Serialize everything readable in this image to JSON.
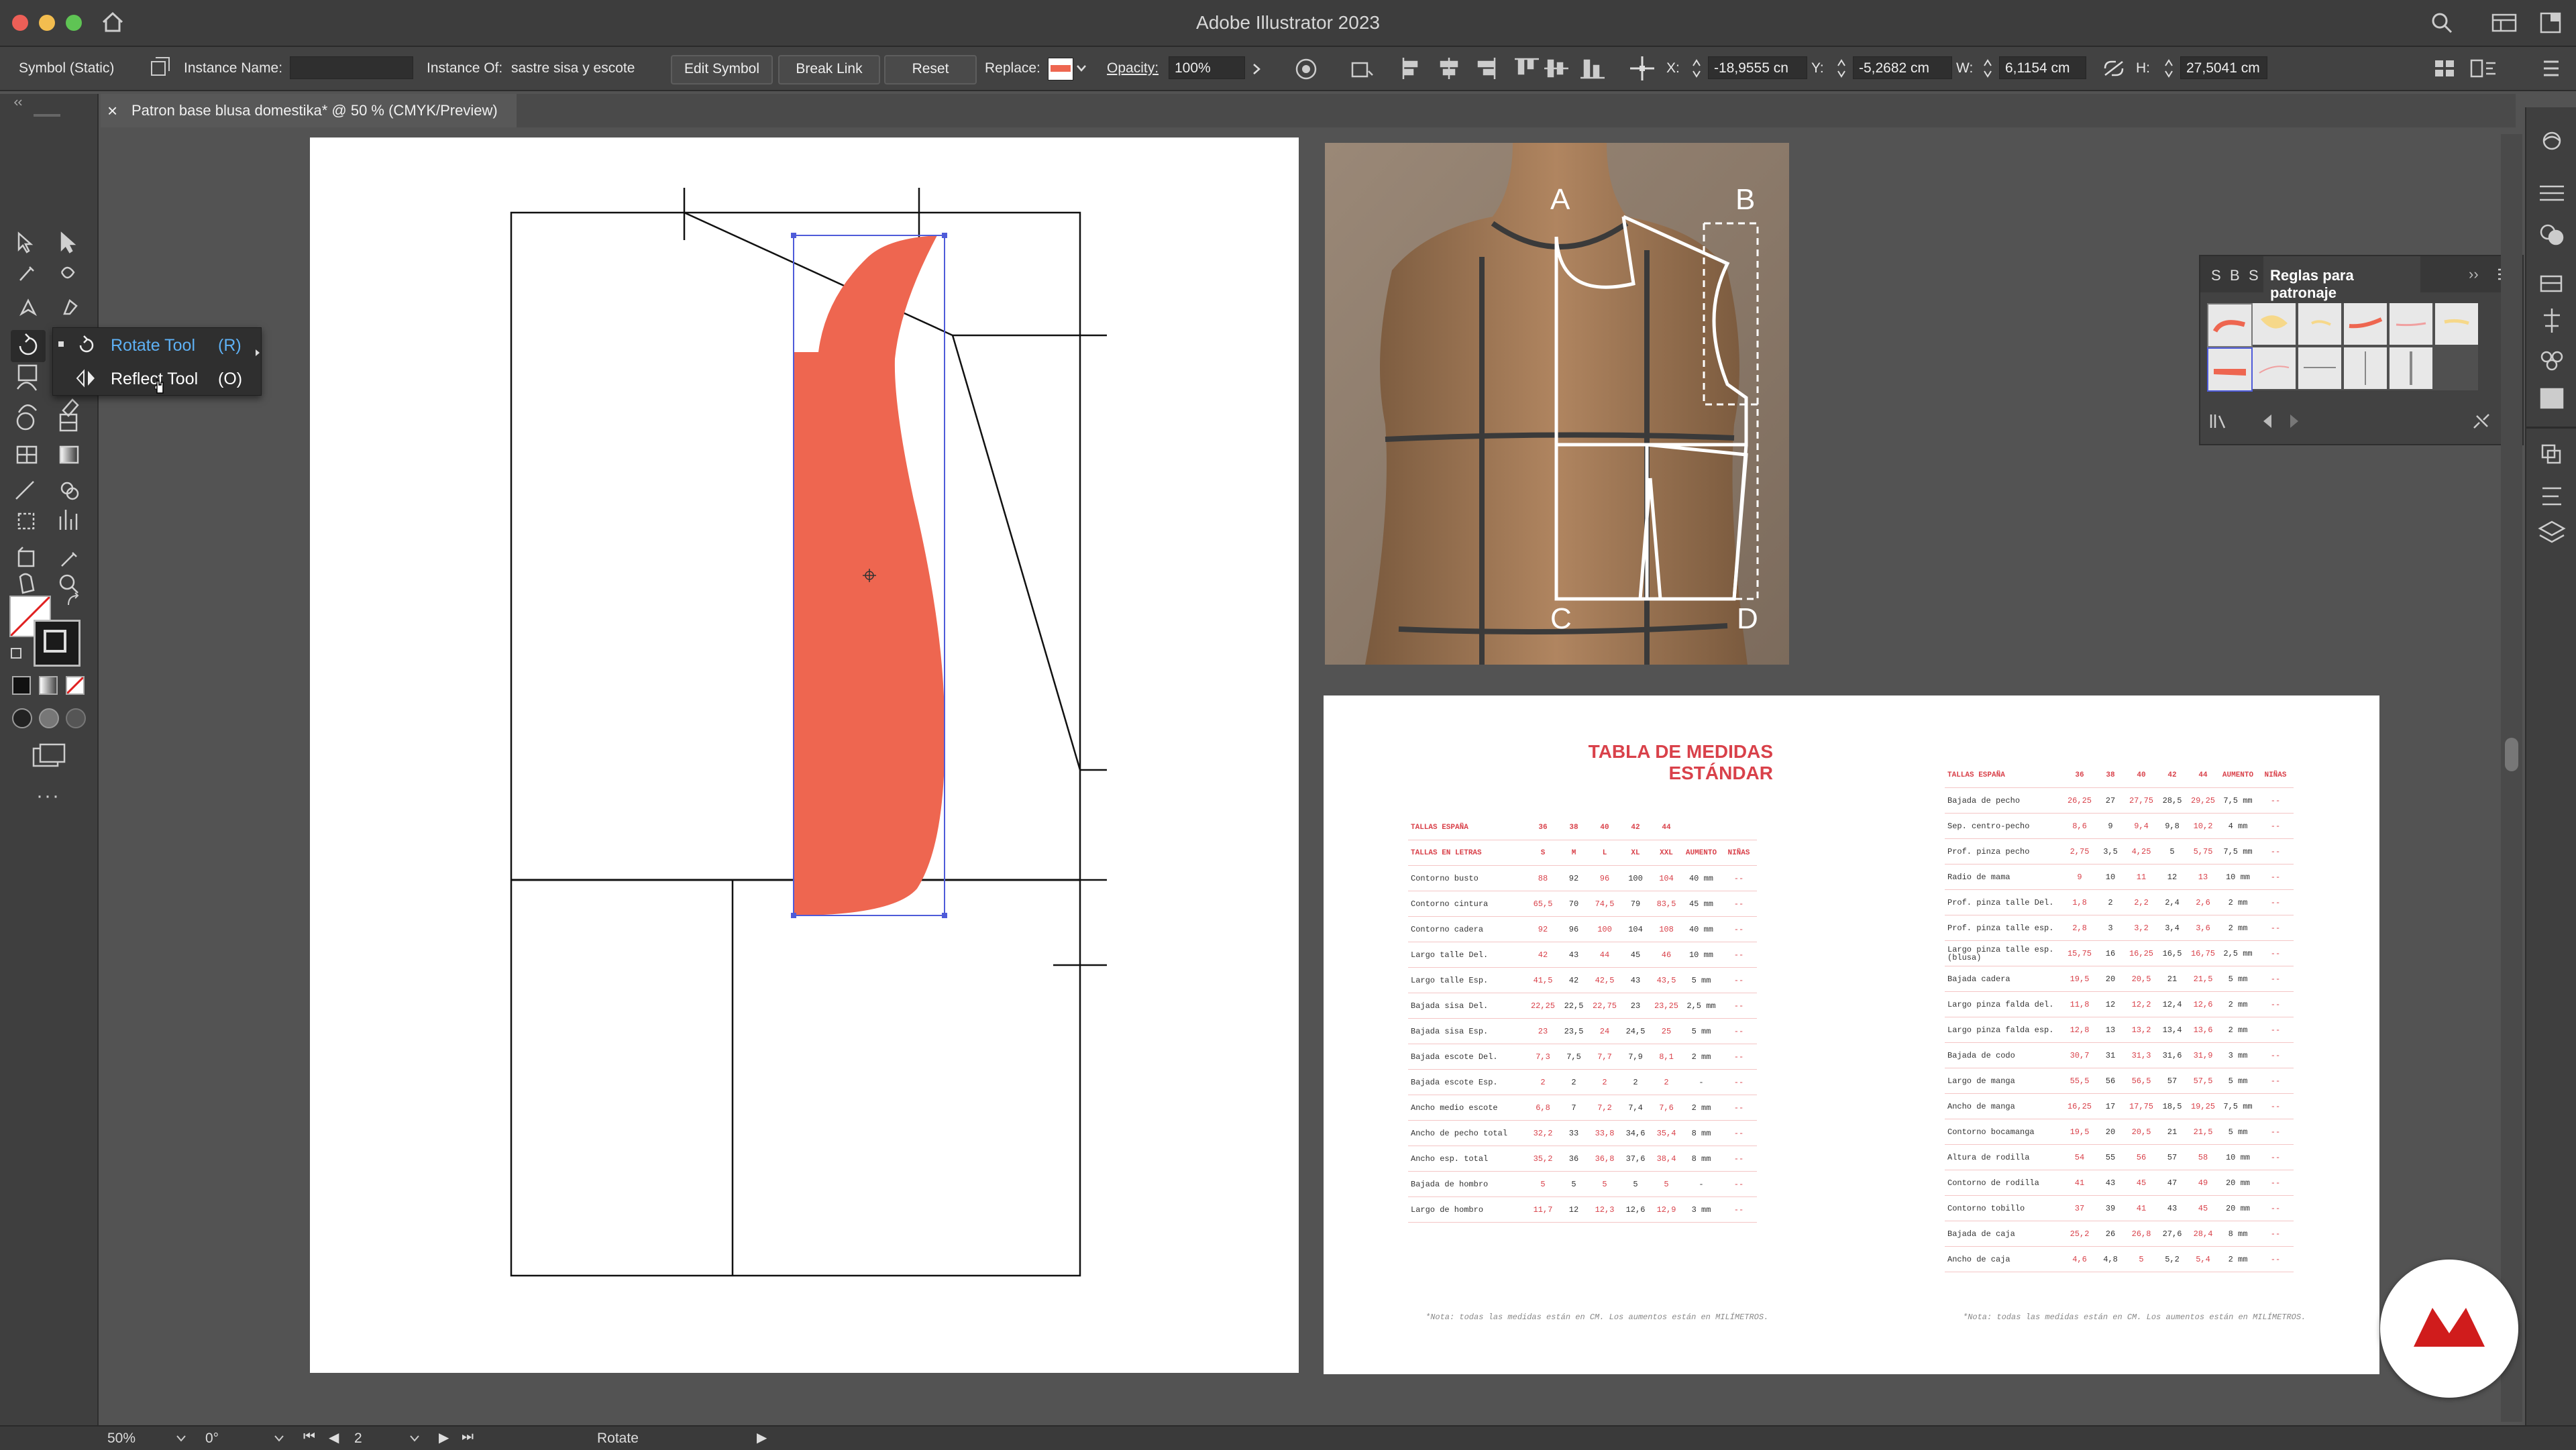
{
  "window": {
    "title": "Adobe Illustrator 2023"
  },
  "control_bar": {
    "selection_type": "Symbol (Static)",
    "instance_name_label": "Instance Name:",
    "instance_name_value": "",
    "instance_of_label": "Instance Of:",
    "instance_of_value": "sastre sisa y escote",
    "edit_symbol": "Edit Symbol",
    "break_link": "Break Link",
    "reset": "Reset",
    "replace_label": "Replace:",
    "opacity_label": "Opacity:",
    "opacity_value": "100%",
    "x_label": "X:",
    "x_value": "-18,9555 cn",
    "y_label": "Y:",
    "y_value": "-5,2682 cm",
    "w_label": "W:",
    "w_value": "6,1154 cm",
    "h_label": "H:",
    "h_value": "27,5041 cm"
  },
  "document_tab": {
    "close": "×",
    "title": "Patron base blusa domestika* @ 50 % (CMYK/Preview)"
  },
  "flyout": {
    "rotate_label": "Rotate Tool",
    "rotate_key": "(R)",
    "reflect_label": "Reflect Tool",
    "reflect_key": "(O)"
  },
  "photo_labels": {
    "a": "A",
    "b": "B",
    "c": "C",
    "d": "D"
  },
  "panel": {
    "tabs": [
      "S",
      "B",
      "S"
    ],
    "title": "Reglas para patronaje",
    "collapse": "››"
  },
  "status_bar": {
    "zoom": "50%",
    "rotation": "0°",
    "artboard": "2",
    "tool": "Rotate"
  },
  "colors": {
    "accent_shape": "#ee6650",
    "selection": "#4e5bd9",
    "table_red": "#d9414a"
  },
  "measurements_table": {
    "title_line1": "TABLA DE MEDIDAS",
    "title_line2": "ESTÁNDAR",
    "left": {
      "header_rows": [
        [
          "TALLAS ESPAÑA",
          "36",
          "38",
          "40",
          "42",
          "44",
          "",
          ""
        ],
        [
          "TALLAS EN LETRAS",
          "S",
          "M",
          "L",
          "XL",
          "XXL",
          "AUMENTO",
          "NIÑAS"
        ]
      ],
      "rows": [
        [
          "Contorno busto",
          "88",
          "92",
          "96",
          "100",
          "104",
          "40 mm",
          "--"
        ],
        [
          "Contorno cintura",
          "65,5",
          "70",
          "74,5",
          "79",
          "83,5",
          "45 mm",
          "--"
        ],
        [
          "Contorno cadera",
          "92",
          "96",
          "100",
          "104",
          "108",
          "40 mm",
          "--"
        ],
        [
          "Largo talle Del.",
          "42",
          "43",
          "44",
          "45",
          "46",
          "10 mm",
          "--"
        ],
        [
          "Largo talle Esp.",
          "41,5",
          "42",
          "42,5",
          "43",
          "43,5",
          "5 mm",
          "--"
        ],
        [
          "Bajada sisa Del.",
          "22,25",
          "22,5",
          "22,75",
          "23",
          "23,25",
          "2,5 mm",
          "--"
        ],
        [
          "Bajada sisa Esp.",
          "23",
          "23,5",
          "24",
          "24,5",
          "25",
          "5 mm",
          "--"
        ],
        [
          "Bajada escote Del.",
          "7,3",
          "7,5",
          "7,7",
          "7,9",
          "8,1",
          "2 mm",
          "--"
        ],
        [
          "Bajada escote Esp.",
          "2",
          "2",
          "2",
          "2",
          "2",
          "-",
          "--"
        ],
        [
          "Ancho medio escote",
          "6,8",
          "7",
          "7,2",
          "7,4",
          "7,6",
          "2 mm",
          "--"
        ],
        [
          "Ancho de pecho total",
          "32,2",
          "33",
          "33,8",
          "34,6",
          "35,4",
          "8 mm",
          "--"
        ],
        [
          "Ancho esp. total",
          "35,2",
          "36",
          "36,8",
          "37,6",
          "38,4",
          "8 mm",
          "--"
        ],
        [
          "Bajada de hombro",
          "5",
          "5",
          "5",
          "5",
          "5",
          "-",
          "--"
        ],
        [
          "Largo de hombro",
          "11,7",
          "12",
          "12,3",
          "12,6",
          "12,9",
          "3 mm",
          "--"
        ]
      ],
      "note": "*Nota: todas las medidas están en CM. Los aumentos están en MILÍMETROS."
    },
    "right": {
      "header_row": [
        "TALLAS ESPAÑA",
        "36",
        "38",
        "40",
        "42",
        "44",
        "AUMENTO",
        "NIÑAS"
      ],
      "rows": [
        [
          "Bajada de pecho",
          "26,25",
          "27",
          "27,75",
          "28,5",
          "29,25",
          "7,5 mm",
          "--"
        ],
        [
          "Sep. centro-pecho",
          "8,6",
          "9",
          "9,4",
          "9,8",
          "10,2",
          "4 mm",
          "--"
        ],
        [
          "Prof. pinza pecho",
          "2,75",
          "3,5",
          "4,25",
          "5",
          "5,75",
          "7,5 mm",
          "--"
        ],
        [
          "Radio de mama",
          "9",
          "10",
          "11",
          "12",
          "13",
          "10 mm",
          "--"
        ],
        [
          "Prof. pinza talle Del.",
          "1,8",
          "2",
          "2,2",
          "2,4",
          "2,6",
          "2 mm",
          "--"
        ],
        [
          "Prof. pinza talle esp.",
          "2,8",
          "3",
          "3,2",
          "3,4",
          "3,6",
          "2 mm",
          "--"
        ],
        [
          "Largo pinza talle esp. (blusa)",
          "15,75",
          "16",
          "16,25",
          "16,5",
          "16,75",
          "2,5 mm",
          "--"
        ],
        [
          "Bajada cadera",
          "19,5",
          "20",
          "20,5",
          "21",
          "21,5",
          "5 mm",
          "--"
        ],
        [
          "Largo pinza falda del.",
          "11,8",
          "12",
          "12,2",
          "12,4",
          "12,6",
          "2 mm",
          "--"
        ],
        [
          "Largo pinza falda esp.",
          "12,8",
          "13",
          "13,2",
          "13,4",
          "13,6",
          "2 mm",
          "--"
        ],
        [
          "Bajada de codo",
          "30,7",
          "31",
          "31,3",
          "31,6",
          "31,9",
          "3 mm",
          "--"
        ],
        [
          "Largo de manga",
          "55,5",
          "56",
          "56,5",
          "57",
          "57,5",
          "5 mm",
          "--"
        ],
        [
          "Ancho de manga",
          "16,25",
          "17",
          "17,75",
          "18,5",
          "19,25",
          "7,5 mm",
          "--"
        ],
        [
          "Contorno bocamanga",
          "19,5",
          "20",
          "20,5",
          "21",
          "21,5",
          "5 mm",
          "--"
        ],
        [
          "Altura de rodilla",
          "54",
          "55",
          "56",
          "57",
          "58",
          "10 mm",
          "--"
        ],
        [
          "Contorno de rodilla",
          "41",
          "43",
          "45",
          "47",
          "49",
          "20 mm",
          "--"
        ],
        [
          "Contorno tobillo",
          "37",
          "39",
          "41",
          "43",
          "45",
          "20 mm",
          "--"
        ],
        [
          "Bajada de caja",
          "25,2",
          "26",
          "26,8",
          "27,6",
          "28,4",
          "8 mm",
          "--"
        ],
        [
          "Ancho de caja",
          "4,6",
          "4,8",
          "5",
          "5,2",
          "5,4",
          "2 mm",
          "--"
        ]
      ],
      "note": "*Nota: todas las medidas están en CM. Los aumentos están en MILÍMETROS."
    }
  }
}
